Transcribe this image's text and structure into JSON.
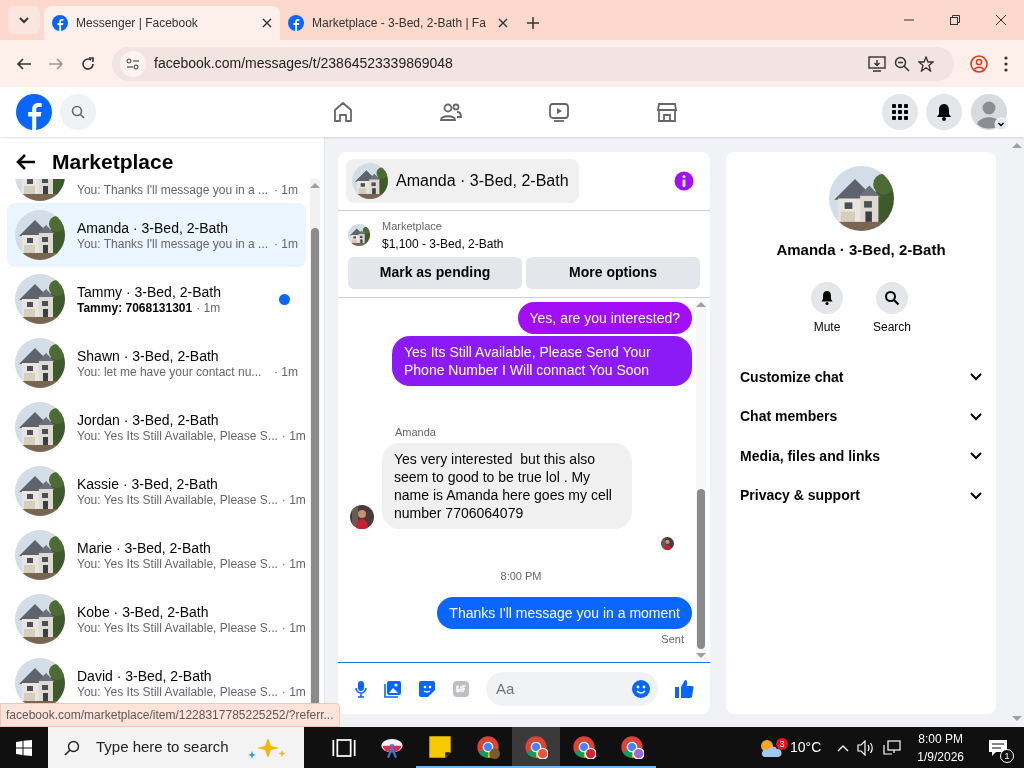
{
  "browser": {
    "tabs": [
      {
        "title": "Messenger | Facebook",
        "selected": true
      },
      {
        "title": "Marketplace - 3-Bed, 2-Bath | Fa",
        "selected": false
      }
    ],
    "url": "facebook.com/messages/t/23864523339869048"
  },
  "sidebar": {
    "title": "Marketplace",
    "conversations": [
      {
        "preview": "You: Thanks I'll message you in a ...",
        "time": "· 1m",
        "selected": false,
        "unread": false
      },
      {
        "name": "Amanda · 3-Bed, 2-Bath",
        "preview": "You: Thanks I'll message you in a ...",
        "time": "· 1m",
        "selected": true,
        "unread": false
      },
      {
        "name": "Tammy · 3-Bed, 2-Bath",
        "preview": "Tammy: 7068131301",
        "time": "· 1m",
        "selected": false,
        "unread": true
      },
      {
        "name": "Shawn · 3-Bed, 2-Bath",
        "preview": "You: let me have your contact nu...",
        "time": "· 1m",
        "selected": false,
        "unread": false
      },
      {
        "name": "Jordan · 3-Bed, 2-Bath",
        "preview": "You: Yes Its Still Available, Please S...",
        "time": "· 1m",
        "selected": false,
        "unread": false
      },
      {
        "name": "Kassie · 3-Bed, 2-Bath",
        "preview": "You: Yes Its Still Available, Please S...",
        "time": "· 1m",
        "selected": false,
        "unread": false
      },
      {
        "name": "Marie · 3-Bed, 2-Bath",
        "preview": "You: Yes Its Still Available, Please S...",
        "time": "· 1m",
        "selected": false,
        "unread": false
      },
      {
        "name": "Kobe · 3-Bed, 2-Bath",
        "preview": "You: Yes Its Still Available, Please S...",
        "time": "· 1m",
        "selected": false,
        "unread": false
      },
      {
        "name": "David · 3-Bed, 2-Bath",
        "preview": "You: Yes Its Still Available, Please S...",
        "time": "· 1m",
        "selected": false,
        "unread": false
      }
    ]
  },
  "chat": {
    "title": "Amanda · 3-Bed, 2-Bath",
    "listing": {
      "source": "Marketplace",
      "price": "$1,100 - 3-Bed, 2-Bath"
    },
    "buttons": [
      "Mark as pending",
      "More options"
    ],
    "messages": [
      {
        "kind": "outgoing",
        "text": "Yes, are you interested?",
        "color": "#a20ff7"
      },
      {
        "kind": "outgoing",
        "text": "Yes Its Still Available, Please Send Your Phone Number I Will connact You Soon",
        "color": "#8c1af6"
      },
      {
        "kind": "incoming",
        "sender": "Amanda",
        "text": "Yes very interested  but this also seem to good to be true lol . My name is Amanda here goes my cell number 7706064079"
      },
      {
        "kind": "seen"
      },
      {
        "kind": "time",
        "text": "8:00 PM"
      },
      {
        "kind": "outgoing",
        "text": "Thanks I'll message you in a moment",
        "color": "#0a66ff"
      },
      {
        "kind": "status",
        "text": "Sent"
      }
    ],
    "composer": {
      "placeholder": "Aa"
    }
  },
  "details": {
    "name": "Amanda · 3-Bed, 2-Bath",
    "actions": [
      "Mute",
      "Search"
    ],
    "sections": [
      {
        "label": "Customize chat",
        "expanded": false
      },
      {
        "label": "Chat members",
        "expanded": false
      },
      {
        "label": "Media, files and links",
        "expanded": false
      },
      {
        "label": "Privacy & support",
        "expanded": false
      }
    ]
  },
  "status_link": "facebook.com/marketplace/item/1228317785225252/?referr...",
  "taskbar": {
    "search_placeholder": "Type here to search",
    "weather_badge": "3",
    "temperature": "10°C",
    "time": "8:00 PM",
    "date": "1/9/2026",
    "notifications": "1"
  }
}
